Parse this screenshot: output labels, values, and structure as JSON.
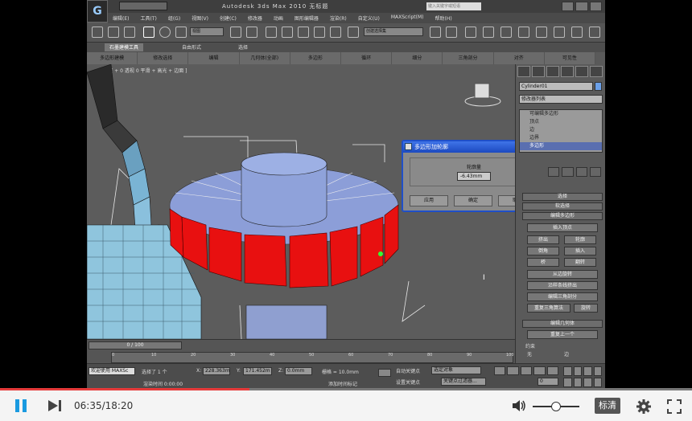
{
  "app": {
    "title": "Autodesk 3ds Max  2010     无标题",
    "logo": "G",
    "menu": [
      "编辑(E)",
      "工具(T)",
      "组(G)",
      "视图(V)",
      "创建(C)",
      "修改器",
      "动画",
      "图形编辑器",
      "渲染(R)",
      "自定义(U)",
      "MAXScript(M)",
      "帮助(H)"
    ],
    "search_placeholder": "键入关键字或短语"
  },
  "toolbar": {
    "view_combo": "视图",
    "selection_set": "创建选择集"
  },
  "ribbon": {
    "tabs": [
      "石墨建模工具",
      "自由形式",
      "选择"
    ],
    "row": [
      "多边形建模",
      "修改选择",
      "编辑",
      "几何体(全部)",
      "多边形",
      "循环",
      "细分",
      "三角剖分",
      "对齐",
      "可见性"
    ]
  },
  "viewport": {
    "label": "[ + 0 透视 0 平滑 + 高光 + 边面 ]"
  },
  "command_panel": {
    "object_name": "Cylinder01",
    "modifier_list": "修改器列表",
    "stack": [
      "可编辑多边形",
      "顶点",
      "边",
      "边界",
      "多边形",
      "元素"
    ],
    "selected_index": 4,
    "rollouts": [
      "选择",
      "软选择",
      "编辑多边形",
      "编辑几何体",
      "约束"
    ],
    "buttons": {
      "insert_vertex": "插入顶点",
      "extrude": "挤出",
      "outline": "轮廓",
      "bevel": "倒角",
      "inset": "插入",
      "bridge": "桥",
      "flip": "翻转",
      "hinge": "从边旋转",
      "extrude_spline": "沿样条线挤出",
      "edit_tri": "编辑三角剖分",
      "retriangulate": "重复三角算法",
      "turn": "旋转",
      "repeat_last": "重复上一个"
    },
    "constraint_none": "无",
    "constraint_edge": "边"
  },
  "dialog": {
    "title": "多边形加轮廓",
    "field_label": "轮廓量",
    "value": "-6.43mm",
    "buttons": [
      "应用",
      "确定",
      "取消"
    ]
  },
  "timeline": {
    "slider": "0 / 100",
    "ticks": [
      "0",
      "10",
      "20",
      "30",
      "40",
      "50",
      "60",
      "70",
      "80",
      "90",
      "100"
    ]
  },
  "status": {
    "welcome": "欢迎使用 MAXSc",
    "selected": "选择了 1 个",
    "x_label": "X:",
    "x": "228.363m",
    "y_label": "Y:",
    "y": "171.452m",
    "z_label": "Z:",
    "z": "0.0mm",
    "grid": "栅格 = 10.0mm",
    "auto_key": "自动关键点",
    "selected_obj": "选定对象",
    "set_key": "设置关键点",
    "key_filter": "关键点过滤器...",
    "add_time_tag": "添加时间标记",
    "render_time": "渲染时间 0:00:00",
    "frame": "0"
  },
  "player": {
    "current": "06:35",
    "total": "18:20",
    "time_sep": "/",
    "progress": 0.36,
    "volume": 0.5,
    "quality": "标清",
    "accent": "#1a9ae0",
    "progress_color": "#e53a3a"
  }
}
